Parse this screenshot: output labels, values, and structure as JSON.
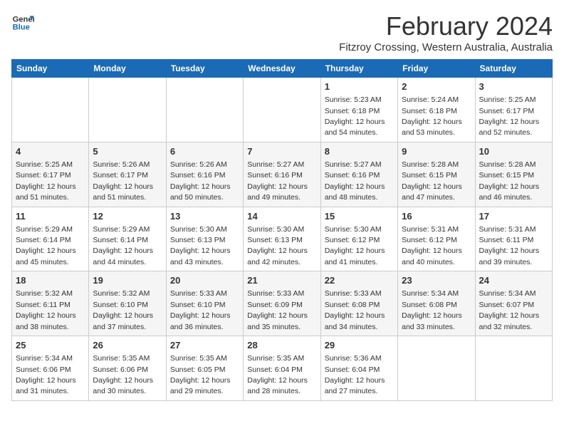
{
  "logo": {
    "line1": "General",
    "line2": "Blue"
  },
  "title": "February 2024",
  "subtitle": "Fitzroy Crossing, Western Australia, Australia",
  "days_of_week": [
    "Sunday",
    "Monday",
    "Tuesday",
    "Wednesday",
    "Thursday",
    "Friday",
    "Saturday"
  ],
  "weeks": [
    [
      {
        "day": "",
        "info": ""
      },
      {
        "day": "",
        "info": ""
      },
      {
        "day": "",
        "info": ""
      },
      {
        "day": "",
        "info": ""
      },
      {
        "day": "1",
        "info": "Sunrise: 5:23 AM\nSunset: 6:18 PM\nDaylight: 12 hours\nand 54 minutes."
      },
      {
        "day": "2",
        "info": "Sunrise: 5:24 AM\nSunset: 6:18 PM\nDaylight: 12 hours\nand 53 minutes."
      },
      {
        "day": "3",
        "info": "Sunrise: 5:25 AM\nSunset: 6:17 PM\nDaylight: 12 hours\nand 52 minutes."
      }
    ],
    [
      {
        "day": "4",
        "info": "Sunrise: 5:25 AM\nSunset: 6:17 PM\nDaylight: 12 hours\nand 51 minutes."
      },
      {
        "day": "5",
        "info": "Sunrise: 5:26 AM\nSunset: 6:17 PM\nDaylight: 12 hours\nand 51 minutes."
      },
      {
        "day": "6",
        "info": "Sunrise: 5:26 AM\nSunset: 6:16 PM\nDaylight: 12 hours\nand 50 minutes."
      },
      {
        "day": "7",
        "info": "Sunrise: 5:27 AM\nSunset: 6:16 PM\nDaylight: 12 hours\nand 49 minutes."
      },
      {
        "day": "8",
        "info": "Sunrise: 5:27 AM\nSunset: 6:16 PM\nDaylight: 12 hours\nand 48 minutes."
      },
      {
        "day": "9",
        "info": "Sunrise: 5:28 AM\nSunset: 6:15 PM\nDaylight: 12 hours\nand 47 minutes."
      },
      {
        "day": "10",
        "info": "Sunrise: 5:28 AM\nSunset: 6:15 PM\nDaylight: 12 hours\nand 46 minutes."
      }
    ],
    [
      {
        "day": "11",
        "info": "Sunrise: 5:29 AM\nSunset: 6:14 PM\nDaylight: 12 hours\nand 45 minutes."
      },
      {
        "day": "12",
        "info": "Sunrise: 5:29 AM\nSunset: 6:14 PM\nDaylight: 12 hours\nand 44 minutes."
      },
      {
        "day": "13",
        "info": "Sunrise: 5:30 AM\nSunset: 6:13 PM\nDaylight: 12 hours\nand 43 minutes."
      },
      {
        "day": "14",
        "info": "Sunrise: 5:30 AM\nSunset: 6:13 PM\nDaylight: 12 hours\nand 42 minutes."
      },
      {
        "day": "15",
        "info": "Sunrise: 5:30 AM\nSunset: 6:12 PM\nDaylight: 12 hours\nand 41 minutes."
      },
      {
        "day": "16",
        "info": "Sunrise: 5:31 AM\nSunset: 6:12 PM\nDaylight: 12 hours\nand 40 minutes."
      },
      {
        "day": "17",
        "info": "Sunrise: 5:31 AM\nSunset: 6:11 PM\nDaylight: 12 hours\nand 39 minutes."
      }
    ],
    [
      {
        "day": "18",
        "info": "Sunrise: 5:32 AM\nSunset: 6:11 PM\nDaylight: 12 hours\nand 38 minutes."
      },
      {
        "day": "19",
        "info": "Sunrise: 5:32 AM\nSunset: 6:10 PM\nDaylight: 12 hours\nand 37 minutes."
      },
      {
        "day": "20",
        "info": "Sunrise: 5:33 AM\nSunset: 6:10 PM\nDaylight: 12 hours\nand 36 minutes."
      },
      {
        "day": "21",
        "info": "Sunrise: 5:33 AM\nSunset: 6:09 PM\nDaylight: 12 hours\nand 35 minutes."
      },
      {
        "day": "22",
        "info": "Sunrise: 5:33 AM\nSunset: 6:08 PM\nDaylight: 12 hours\nand 34 minutes."
      },
      {
        "day": "23",
        "info": "Sunrise: 5:34 AM\nSunset: 6:08 PM\nDaylight: 12 hours\nand 33 minutes."
      },
      {
        "day": "24",
        "info": "Sunrise: 5:34 AM\nSunset: 6:07 PM\nDaylight: 12 hours\nand 32 minutes."
      }
    ],
    [
      {
        "day": "25",
        "info": "Sunrise: 5:34 AM\nSunset: 6:06 PM\nDaylight: 12 hours\nand 31 minutes."
      },
      {
        "day": "26",
        "info": "Sunrise: 5:35 AM\nSunset: 6:06 PM\nDaylight: 12 hours\nand 30 minutes."
      },
      {
        "day": "27",
        "info": "Sunrise: 5:35 AM\nSunset: 6:05 PM\nDaylight: 12 hours\nand 29 minutes."
      },
      {
        "day": "28",
        "info": "Sunrise: 5:35 AM\nSunset: 6:04 PM\nDaylight: 12 hours\nand 28 minutes."
      },
      {
        "day": "29",
        "info": "Sunrise: 5:36 AM\nSunset: 6:04 PM\nDaylight: 12 hours\nand 27 minutes."
      },
      {
        "day": "",
        "info": ""
      },
      {
        "day": "",
        "info": ""
      }
    ]
  ]
}
